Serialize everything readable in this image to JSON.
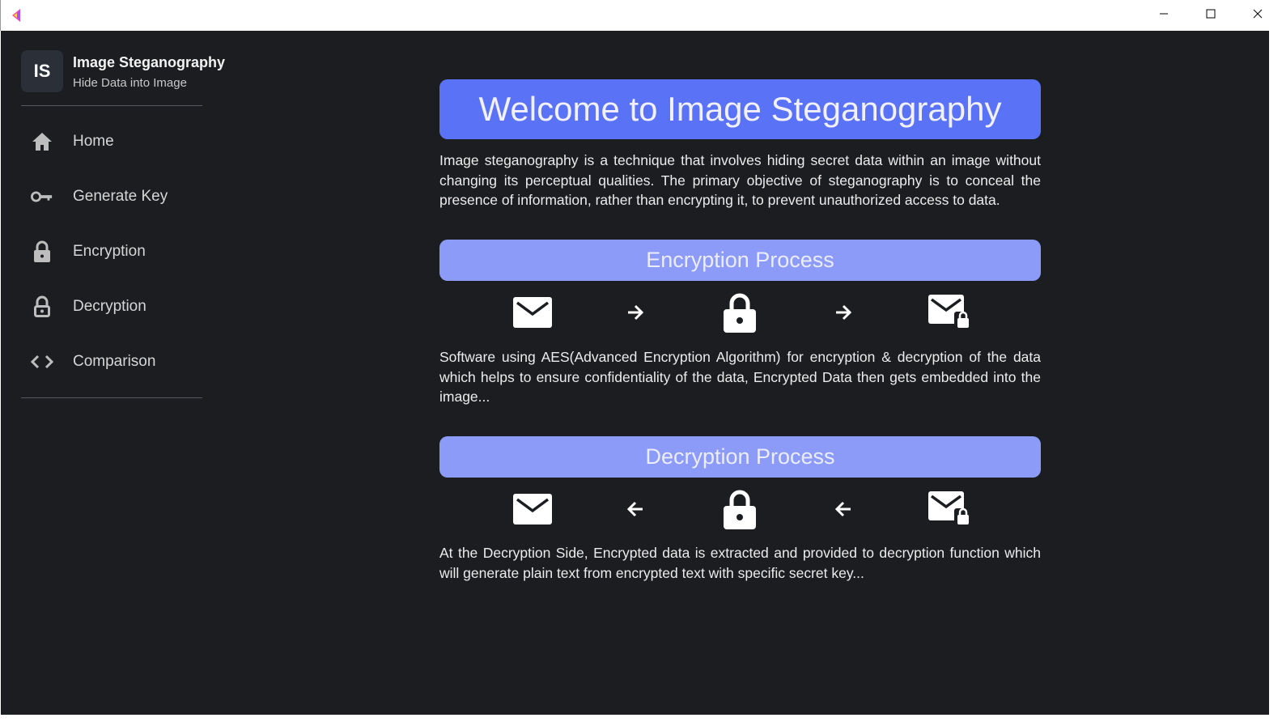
{
  "window": {
    "logo_icon": "app-logo-icon",
    "controls": [
      "minimize-icon",
      "maximize-icon",
      "close-icon"
    ]
  },
  "sidebar": {
    "avatar": "IS",
    "title": "Image Steganography",
    "subtitle": "Hide Data into Image",
    "items": [
      {
        "label": "Home",
        "icon": "home-icon"
      },
      {
        "label": "Generate Key",
        "icon": "key-icon"
      },
      {
        "label": "Encryption",
        "icon": "lock-icon"
      },
      {
        "label": "Decryption",
        "icon": "unlock-icon"
      },
      {
        "label": "Comparison",
        "icon": "code-icon"
      }
    ]
  },
  "main": {
    "welcome": "Welcome to Image Steganography",
    "intro": "Image steganography is a technique that involves hiding secret data within an image without changing its perceptual qualities. The primary objective of steganography is to conceal the presence of information, rather than encrypting it, to prevent unauthorized access to data.",
    "encryption": {
      "title": "Encryption Process",
      "flow": [
        "mail-icon",
        "arrow-right-icon",
        "lock-icon",
        "arrow-right-icon",
        "mail-lock-icon"
      ],
      "description": "Software using AES(Advanced Encryption Algorithm) for encryption & decryption of the data which helps to ensure confidentiality of the data, Encrypted Data then gets embedded into the image..."
    },
    "decryption": {
      "title": "Decryption Process",
      "flow": [
        "mail-icon",
        "arrow-left-icon",
        "lock-icon",
        "arrow-left-icon",
        "mail-lock-icon"
      ],
      "description": "At the Decryption Side, Encrypted data is extracted and provided to decryption function which will generate plain text from encrypted text with specific secret key..."
    }
  },
  "colors": {
    "background": "#1c1d20",
    "welcome_banner": "#5a73f6",
    "section_banner": "#8c9bf7",
    "text": "#ececec"
  }
}
